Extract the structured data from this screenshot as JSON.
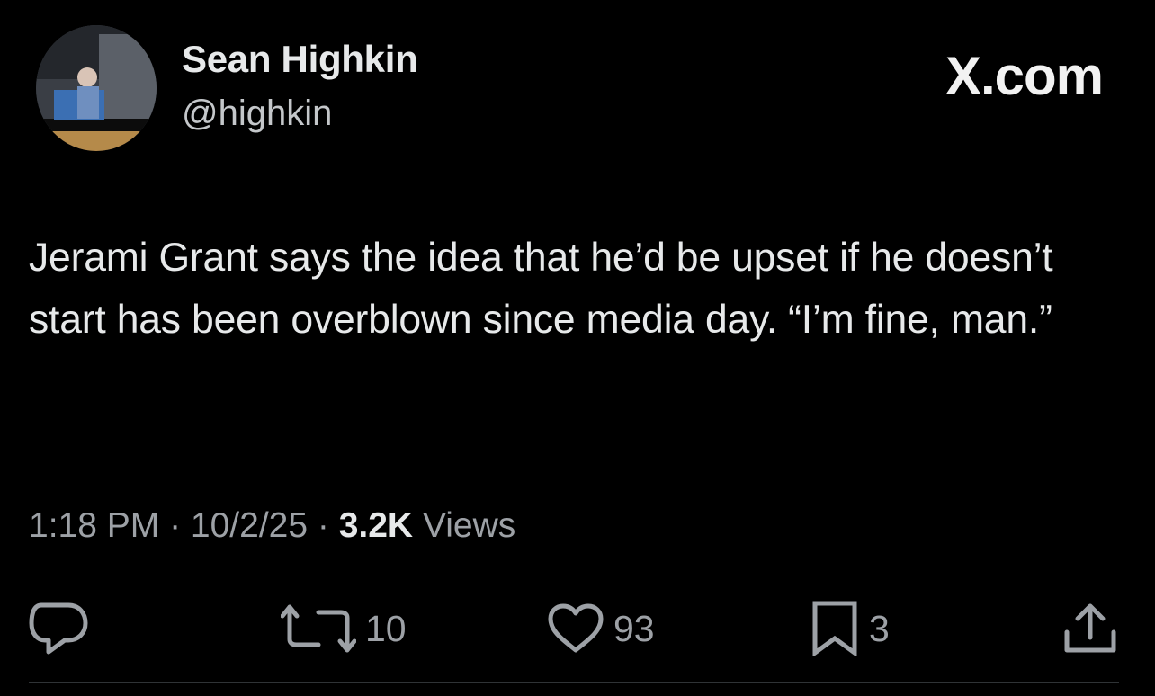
{
  "author": {
    "display_name": "Sean Highkin",
    "handle": "@highkin"
  },
  "brand": "X.com",
  "tweet": {
    "text": "Jerami Grant says the idea that he’d be upset if he doesn’t start has been overblown since media day. “I’m fine, man.”"
  },
  "meta": {
    "time": "1:18 PM",
    "separator": " · ",
    "date": "10/2/25",
    "views_count": "3.2K",
    "views_label": " Views"
  },
  "actions": {
    "reposts": "10",
    "likes": "93",
    "bookmarks": "3"
  },
  "colors": {
    "background": "#000000",
    "text_primary": "#e7e9ea",
    "text_secondary": "#9da1a6"
  },
  "icons": [
    "reply-icon",
    "repost-icon",
    "like-icon",
    "bookmark-icon",
    "share-icon"
  ]
}
